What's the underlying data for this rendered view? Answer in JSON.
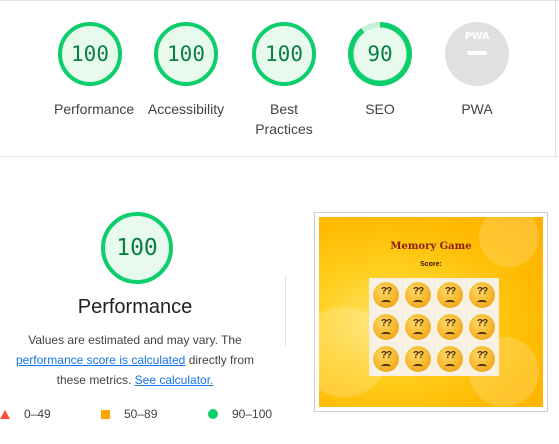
{
  "gauges": [
    {
      "score": "100",
      "label": "Performance"
    },
    {
      "score": "100",
      "label": "Accessibility"
    },
    {
      "score": "100",
      "label": "Best Practices"
    },
    {
      "score": "90",
      "label": "SEO"
    },
    {
      "badge": "PWA",
      "label": "PWA"
    }
  ],
  "performance": {
    "score": "100",
    "title": "Performance",
    "desc_pre": "Values are estimated and may vary. The ",
    "desc_link": "performance score is calculated",
    "desc_mid": " directly from these metrics. ",
    "calc_link": "See calculator."
  },
  "legend": [
    {
      "range": "0–49",
      "shape": "triangle",
      "color": "#ff4e42"
    },
    {
      "range": "50–89",
      "shape": "square",
      "color": "#ffa400"
    },
    {
      "range": "90–100",
      "shape": "circle",
      "color": "#0cce6b"
    }
  ],
  "screenshot": {
    "game_title": "Memory Game",
    "score_label": "Score:",
    "card_text": "??"
  },
  "colors": {
    "pass": "#0cce6b",
    "average": "#ffa400",
    "fail": "#ff4e42",
    "link": "#1a73e8"
  }
}
